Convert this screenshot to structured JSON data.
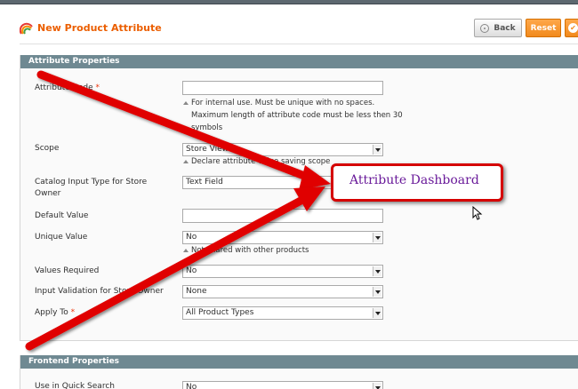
{
  "header": {
    "title": "New Product Attribute",
    "back_label": "Back",
    "reset_label": "Reset",
    "save_glyph": "✔"
  },
  "attribute_properties": {
    "heading": "Attribute Properties",
    "attribute_code": {
      "label": "Attribute Code",
      "required": "*",
      "value": "",
      "note_1": "For internal use. Must be unique with no spaces.",
      "note_2": "Maximum length of attribute code must be less then 30",
      "note_3": "symbols"
    },
    "scope": {
      "label": "Scope",
      "value": "Store View",
      "note": "Declare attribute value saving scope"
    },
    "catalog_input_type": {
      "label_1": "Catalog Input Type for Store",
      "label_2": "Owner",
      "value": "Text Field"
    },
    "default_value": {
      "label": "Default Value",
      "value": ""
    },
    "unique_value": {
      "label": "Unique Value",
      "value": "No",
      "note": "Not shared with other products"
    },
    "values_required": {
      "label": "Values Required",
      "value": "No"
    },
    "input_validation": {
      "label": "Input Validation for Store Owner",
      "value": "None"
    },
    "apply_to": {
      "label": "Apply To",
      "required": "*",
      "value": "All Product Types"
    }
  },
  "frontend_properties": {
    "heading": "Frontend Properties",
    "quick_search": {
      "label": "Use in Quick Search",
      "value": "No"
    }
  },
  "callout": {
    "text": "Attribute Dashboard"
  },
  "colors": {
    "title_orange": "#eb5e00",
    "section_header": "#6f8992",
    "arrow_red": "#e00000",
    "callout_border": "#d50000",
    "callout_text": "#6a1b9a"
  }
}
